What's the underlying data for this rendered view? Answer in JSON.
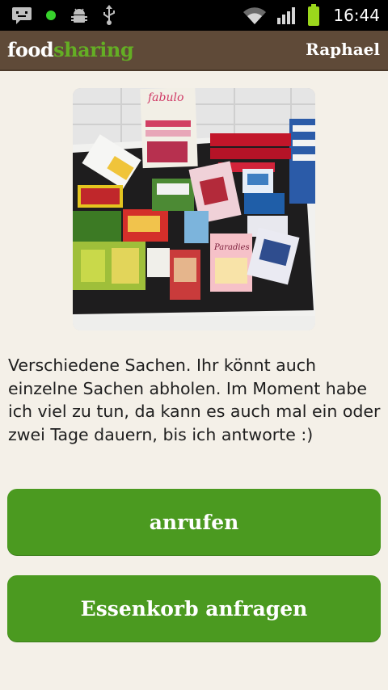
{
  "status_bar": {
    "time": "16:44",
    "icons": [
      "message-icon",
      "notification-dot-icon",
      "android-debug-icon",
      "usb-icon",
      "wifi-icon",
      "signal-icon",
      "battery-icon"
    ]
  },
  "app_bar": {
    "logo_part1": "food",
    "logo_part2": "sharing",
    "user_name": "Raphael"
  },
  "basket": {
    "photo_icon": "food-basket-photo",
    "description": "Verschiedene Sachen. Ihr könnt auch einzelne Sachen abholen. Im Moment habe ich viel zu tun, da kann es auch mal ein oder zwei Tage dauern, bis ich antworte :)"
  },
  "actions": {
    "call_label": "anrufen",
    "request_label": "Essenkorb anfragen"
  },
  "colors": {
    "status_bar": "#000000",
    "app_bar": "#5f4a38",
    "logo_accent": "#64ae24",
    "button": "#4b9a20",
    "background": "#f4f0e8"
  }
}
